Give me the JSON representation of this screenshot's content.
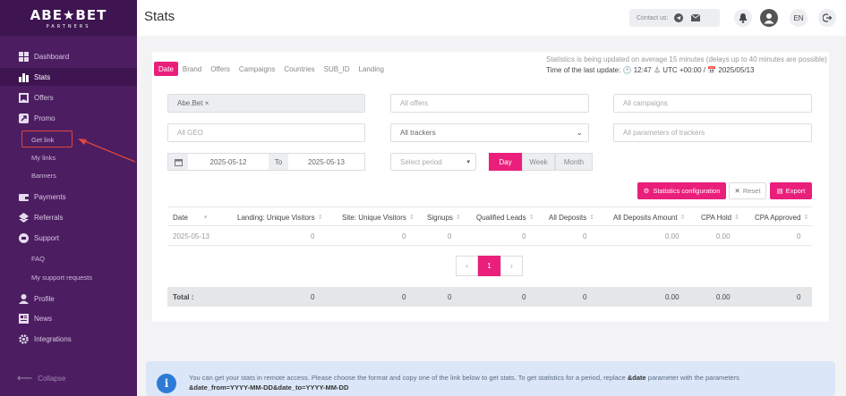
{
  "brand": {
    "logo_main": "ABE★BET",
    "logo_sub": "PARTNERS"
  },
  "sidebar": {
    "items": [
      {
        "label": "Dashboard",
        "icon": "dashboard-icon"
      },
      {
        "label": "Stats",
        "icon": "stats-icon"
      },
      {
        "label": "Offers",
        "icon": "offers-icon"
      },
      {
        "label": "Promo",
        "icon": "promo-icon"
      },
      {
        "label": "Payments",
        "icon": "payments-icon"
      },
      {
        "label": "Referrals",
        "icon": "referrals-icon"
      },
      {
        "label": "Support",
        "icon": "support-icon"
      },
      {
        "label": "Profile",
        "icon": "profile-icon"
      },
      {
        "label": "News",
        "icon": "news-icon"
      },
      {
        "label": "Integrations",
        "icon": "integrations-icon"
      }
    ],
    "promo_sub": [
      "Get link",
      "My links",
      "Banners"
    ],
    "support_sub": [
      "FAQ",
      "My support requests"
    ],
    "collapse": "Collapse"
  },
  "header": {
    "title": "Stats",
    "contact_label": "Contact us:",
    "lang": "EN"
  },
  "tabs": [
    "Date",
    "Brand",
    "Offers",
    "Campaigns",
    "Countries",
    "SUB_ID",
    "Landing"
  ],
  "update_note": {
    "line1": "Statistics is being updated on average 15 minutes (delays up to 40 minutes are possible)",
    "line2_prefix": "Time of the last update:",
    "line2_time": "🕐 12:47 ⏃ UTC +00:00 / 📅 2025/05/13"
  },
  "filters": {
    "brand_value": "Abe.Bet ×",
    "offers_placeholder": "All offers",
    "campaigns_placeholder": "All campaigns",
    "geo_placeholder": "All GEO",
    "trackers_value": "All trackers",
    "tracker_params_placeholder": "All parameters of trackers",
    "date_from": "2025-05-12",
    "date_to_label": "To",
    "date_to": "2025-05-13",
    "period_placeholder": "Select period",
    "period_buttons": [
      "Day",
      "Week",
      "Month"
    ]
  },
  "actions": {
    "stats_config": "Statistics configuration",
    "reset": "Reset",
    "export": "Export"
  },
  "table": {
    "columns": [
      "Date",
      "Landing: Unique Visitors",
      "Site: Unique Visitors",
      "Signups",
      "Qualified Leads",
      "All Deposits",
      "All Deposits Amount",
      "CPA Hold",
      "CPA Approved"
    ],
    "rows": [
      [
        "2025-05-13",
        "0",
        "0",
        "0",
        "0",
        "0",
        "0.00",
        "0.00",
        "0"
      ]
    ],
    "total": [
      "Total :",
      "0",
      "0",
      "0",
      "0",
      "0",
      "0.00",
      "0.00",
      "0"
    ]
  },
  "pagination": {
    "prev": "‹",
    "current": "1",
    "next": "›"
  },
  "info": {
    "text1": "You can get your stats in remote access. Please choose the format and copy one of the link below to get stats. To get statistics for a period, replace ",
    "bold1": "&date",
    "text2": " parameter with the parameters",
    "bold2": "&date_from=YYYY-MM-DD&date_to=YYYY-MM-DD"
  },
  "colors": {
    "sidebar": "#4c1d61",
    "accent": "#ea1f7c",
    "annotation": "#e0473c"
  }
}
